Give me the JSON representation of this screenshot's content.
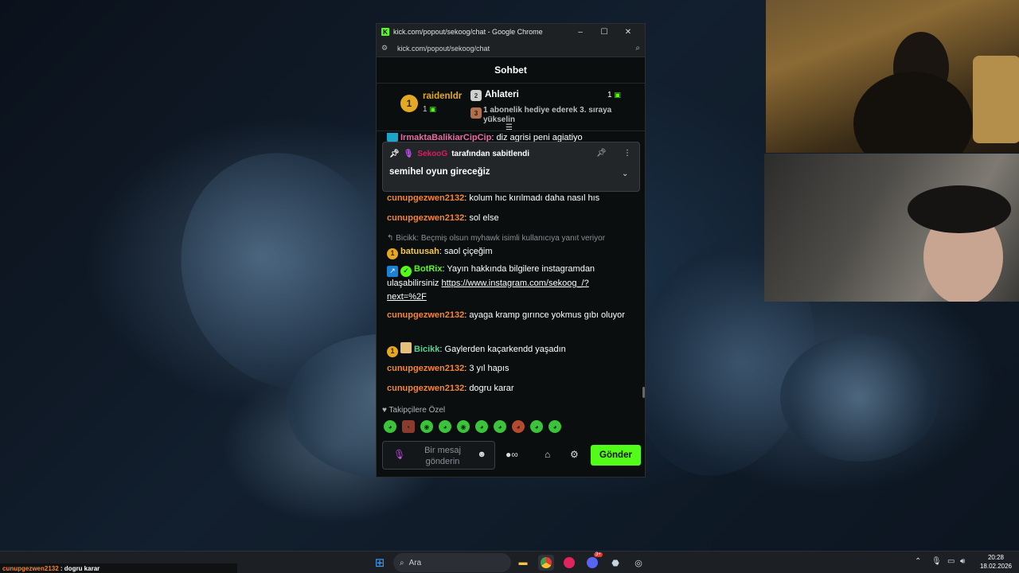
{
  "window": {
    "title": "kick.com/popout/sekoog/chat - Google Chrome",
    "url": "kick.com/popout/sekoog/chat",
    "minimize": "–",
    "maximize": "☐",
    "close": "✕"
  },
  "chat": {
    "header": "Sohbet",
    "leaderboard": {
      "first": {
        "rank": "1",
        "name": "raidenldr",
        "count": "1"
      },
      "second": {
        "rank": "2",
        "name": "Ahlateri",
        "count": "1"
      },
      "third": {
        "rank": "3",
        "text": "1 abonelik hediye ederek 3. sıraya yükselin"
      }
    },
    "hidden_line": {
      "user": "IrmaktaBalikiarCipCip",
      "text": ": diz agrisi peni agiatiyo"
    },
    "pinned": {
      "user": "SekooG",
      "label": "tarafından sabitlendi",
      "message": "semihel oyun gireceğiz"
    },
    "messages": [
      {
        "user": "cunupgezwen2132",
        "text": ": kolum hıc kırılmadı daha nasıl hıs"
      },
      {
        "user": "cunupgezwen2132",
        "text": ": sol else"
      },
      {
        "reply": "Bicikk: Beçmiş olsun myhawk isimli kullanıcıya yanıt veriyor",
        "badge": "1",
        "user": "batuusah",
        "text": ": saol çiçeğim"
      },
      {
        "user": "BotRix",
        "text": ": Yayın hakkında bilgilere instagramdan ulaşabilirsiniz ",
        "link": "https://www.instagram.com/sekoog_/?next=%2F"
      },
      {
        "user": "cunupgezwen2132",
        "text": ": ayaga kramp gırınce yokmus gıbı oluyor"
      },
      {
        "badge": "1",
        "user": "Bicikk",
        "text": ": Gaylerden kaçarkendd yaşadın"
      },
      {
        "user": "cunupgezwen2132",
        "text": ": 3 yıl hapıs"
      },
      {
        "user": "cunupgezwen2132",
        "text": ": dogru karar"
      }
    ],
    "emote_section_label": "Takipçilere Özel",
    "input_placeholder": "Bir mesaj gönderin",
    "send_label": "Gönder"
  },
  "taskbar": {
    "ticker_user": "cunupgezwen2132",
    "ticker_text": " : dogru karar",
    "search_label": "Ara",
    "time": "20:28",
    "date": "18.02.2026",
    "discord_badge": "3+"
  },
  "colors": {
    "kick_green": "#53fc18",
    "username_orange": "#f48534",
    "chat_bg": "#0b0e0f"
  }
}
